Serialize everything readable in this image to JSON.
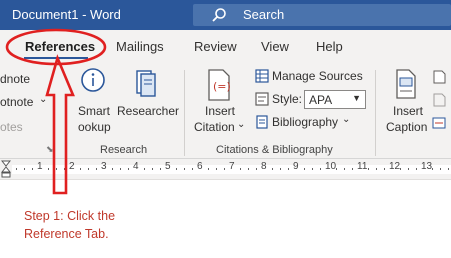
{
  "titlebar": {
    "doc_title": "Document1  -  Word",
    "search_placeholder": "Search"
  },
  "tabs": [
    {
      "label": "References",
      "active": true
    },
    {
      "label": "Mailings"
    },
    {
      "label": "Review"
    },
    {
      "label": "View"
    },
    {
      "label": "Help"
    }
  ],
  "ribbon": {
    "footnotes": {
      "insert_endnote": "dnote",
      "next_footnote": "otnote",
      "show_notes": "otes"
    },
    "research": {
      "smart_lookup_1": "Smart",
      "smart_lookup_2": "ookup",
      "researcher": "Researcher",
      "group_label": "Research"
    },
    "citations": {
      "insert_citation_1": "Insert",
      "insert_citation_2": "Citation",
      "manage_sources": "Manage Sources",
      "style_label": "Style:",
      "style_value": "APA",
      "bibliography": "Bibliography",
      "group_label": "Citations & Bibliography"
    },
    "captions": {
      "insert_caption_1": "Insert",
      "insert_caption_2": "Caption"
    }
  },
  "ruler": {
    "ticks": [
      "1",
      "2",
      "3",
      "4",
      "5",
      "6",
      "7",
      "8",
      "9",
      "10",
      "11",
      "12",
      "13"
    ]
  },
  "annotation": {
    "line1": "Step 1: Click the",
    "line2": "Reference Tab."
  },
  "colors": {
    "word_blue": "#2b579a",
    "annotation_red": "#c0392b",
    "ribbon_bg": "#f3f2f1"
  }
}
